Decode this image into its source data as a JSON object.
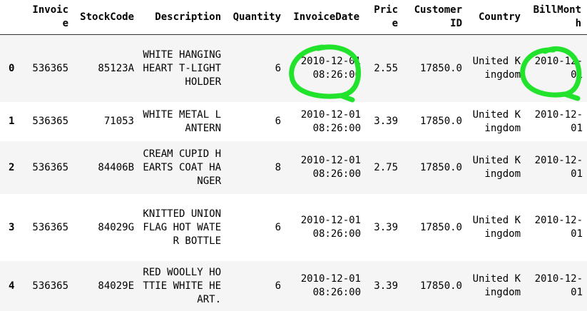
{
  "columns": {
    "invoice": "Invoice",
    "stockcode": "StockCode",
    "description": "Description",
    "quantity": "Quantity",
    "invoicedate": "InvoiceDate",
    "price": "Price",
    "customer": "Customer ID",
    "country": "Country",
    "billmonth": "BillMonth"
  },
  "rows": [
    {
      "index": "0",
      "invoice": "536365",
      "stockcode": "85123A",
      "description": "WHITE HANGING HEART T-LIGHT HOLDER",
      "quantity": "6",
      "invoicedate": "2010-12-01 08:26:00",
      "price": "2.55",
      "customer": "17850.0",
      "country": "United Kingdom",
      "billmonth": "2010-12-01"
    },
    {
      "index": "1",
      "invoice": "536365",
      "stockcode": "71053",
      "description": "WHITE METAL LANTERN",
      "quantity": "6",
      "invoicedate": "2010-12-01 08:26:00",
      "price": "3.39",
      "customer": "17850.0",
      "country": "United Kingdom",
      "billmonth": "2010-12-01"
    },
    {
      "index": "2",
      "invoice": "536365",
      "stockcode": "84406B",
      "description": "CREAM CUPID HEARTS COAT HANGER",
      "quantity": "8",
      "invoicedate": "2010-12-01 08:26:00",
      "price": "2.75",
      "customer": "17850.0",
      "country": "United Kingdom",
      "billmonth": "2010-12-01"
    },
    {
      "index": "3",
      "invoice": "536365",
      "stockcode": "84029G",
      "description": "KNITTED UNION FLAG HOT WATER BOTTLE",
      "quantity": "6",
      "invoicedate": "2010-12-01 08:26:00",
      "price": "3.39",
      "customer": "17850.0",
      "country": "United Kingdom",
      "billmonth": "2010-12-01"
    },
    {
      "index": "4",
      "invoice": "536365",
      "stockcode": "84029E",
      "description": "RED WOOLLY HOTTIE WHITE HEART.",
      "quantity": "6",
      "invoicedate": "2010-12-01 08:26:00",
      "price": "3.39",
      "customer": "17850.0",
      "country": "United Kingdom",
      "billmonth": "2010-12-01"
    }
  ],
  "annotation_color": "#22e32b"
}
